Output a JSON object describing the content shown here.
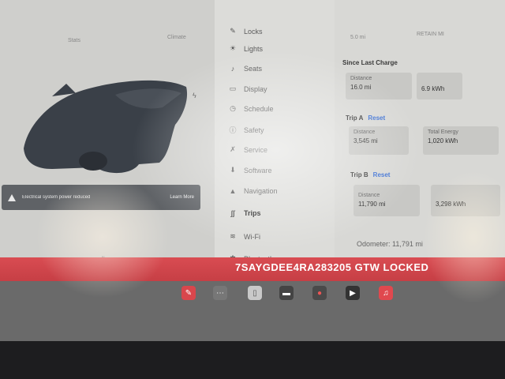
{
  "top_stats": {
    "left_label": "Stats",
    "mid_label": "Climate",
    "right_a": "5.0 mi",
    "right_b": "RETAIN MI"
  },
  "alert": {
    "text": "Electrical system power reduced",
    "link": "Learn More"
  },
  "menu": {
    "items": [
      {
        "icon": "✎",
        "label": "Locks",
        "icon_name": "lock-icon"
      },
      {
        "icon": "☀",
        "label": "Lights",
        "icon_name": "lights-icon"
      },
      {
        "icon": "♪",
        "label": "Seats",
        "icon_name": "seat-icon"
      },
      {
        "icon": "▭",
        "label": "Display",
        "icon_name": "display-icon"
      },
      {
        "icon": "◷",
        "label": "Schedule",
        "icon_name": "schedule-icon"
      },
      {
        "icon": "ⓘ",
        "label": "Safety",
        "icon_name": "safety-icon"
      },
      {
        "icon": "✗",
        "label": "Service",
        "icon_name": "wrench-icon"
      },
      {
        "icon": "⬇",
        "label": "Software",
        "icon_name": "download-icon"
      },
      {
        "icon": "▲",
        "label": "Navigation",
        "icon_name": "navigation-icon"
      },
      {
        "icon": "∫∫",
        "label": "Trips",
        "icon_name": "trips-icon"
      },
      {
        "icon": "≋",
        "label": "Wi-Fi",
        "icon_name": "wifi-icon"
      },
      {
        "icon": "✱",
        "label": "Bluetooth",
        "icon_name": "bluetooth-icon"
      }
    ]
  },
  "trips": {
    "since_last_charge": {
      "title": "Since Last Charge",
      "distance_label": "Distance",
      "distance_value": "16.0 mi",
      "energy_value": "6.9 kWh"
    },
    "trip_a": {
      "title": "Trip A",
      "reset_label": "Reset",
      "distance_label": "Distance",
      "distance_value": "3,545 mi",
      "total_label": "Total Energy",
      "total_value": "1,020 kWh"
    },
    "trip_b": {
      "title": "Trip B",
      "reset_label": "Reset",
      "distance_label": "Distance",
      "distance_value": "11,790 mi",
      "total_value": "3,298 kWh"
    },
    "odometer": "Odometer: 11,791 mi"
  },
  "banner": {
    "text": "7SAYGDEE4RA283205  GTW LOCKED"
  },
  "colors": {
    "banner": "#d94c52",
    "accent": "#3b6fd3",
    "screen": "#d6d6d3"
  }
}
